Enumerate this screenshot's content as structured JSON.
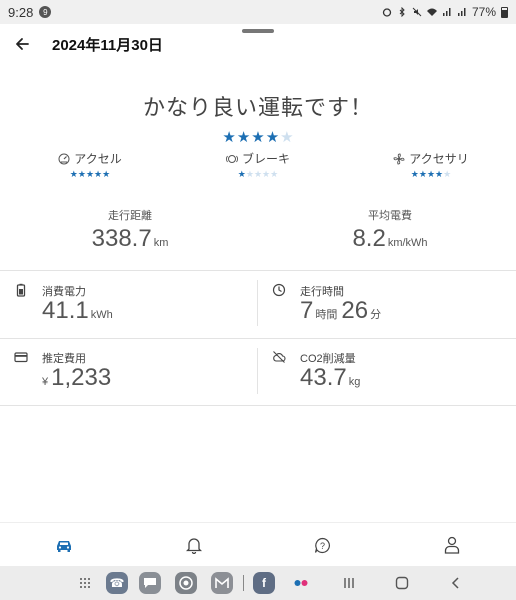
{
  "status_bar": {
    "time": "9:28",
    "notif_badge": "9",
    "battery": "77%"
  },
  "header": {
    "title": "2024年11月30日"
  },
  "rating": {
    "headline": "かなり良い運転です！",
    "stars": 4,
    "max": 5
  },
  "categories": [
    {
      "label": "アクセル",
      "icon": "gauge-icon",
      "stars": 5
    },
    {
      "label": "ブレーキ",
      "icon": "brake-icon",
      "stars": 1
    },
    {
      "label": "アクセサリ",
      "icon": "fan-icon",
      "stars": 4
    }
  ],
  "summary": {
    "distance": {
      "label": "走行距離",
      "value": "338.7",
      "unit": "km"
    },
    "efficiency": {
      "label": "平均電費",
      "value": "8.2",
      "unit": "km/kWh"
    }
  },
  "details": {
    "energy": {
      "label": "消費電力",
      "value": "41.1",
      "unit": "kWh",
      "icon": "battery-icon"
    },
    "time": {
      "label": "走行時間",
      "hours": "7",
      "hours_unit": "時間",
      "minutes": "26",
      "minutes_unit": "分",
      "icon": "clock-icon"
    },
    "cost": {
      "label": "推定費用",
      "prefix": "¥",
      "value": "1,233",
      "icon": "card-icon"
    },
    "co2": {
      "label": "CO2削減量",
      "value": "43.7",
      "unit": "kg",
      "icon": "cloud-off-icon"
    }
  },
  "bottom_nav": [
    {
      "name": "car-icon",
      "active": true
    },
    {
      "name": "bell-icon",
      "active": false
    },
    {
      "name": "help-icon",
      "active": false
    },
    {
      "name": "person-icon",
      "active": false
    }
  ],
  "colors": {
    "accent": "#1d6fb3",
    "star_off": "#cfe0ef",
    "text": "#555555",
    "divider": "#e3e3e3"
  }
}
